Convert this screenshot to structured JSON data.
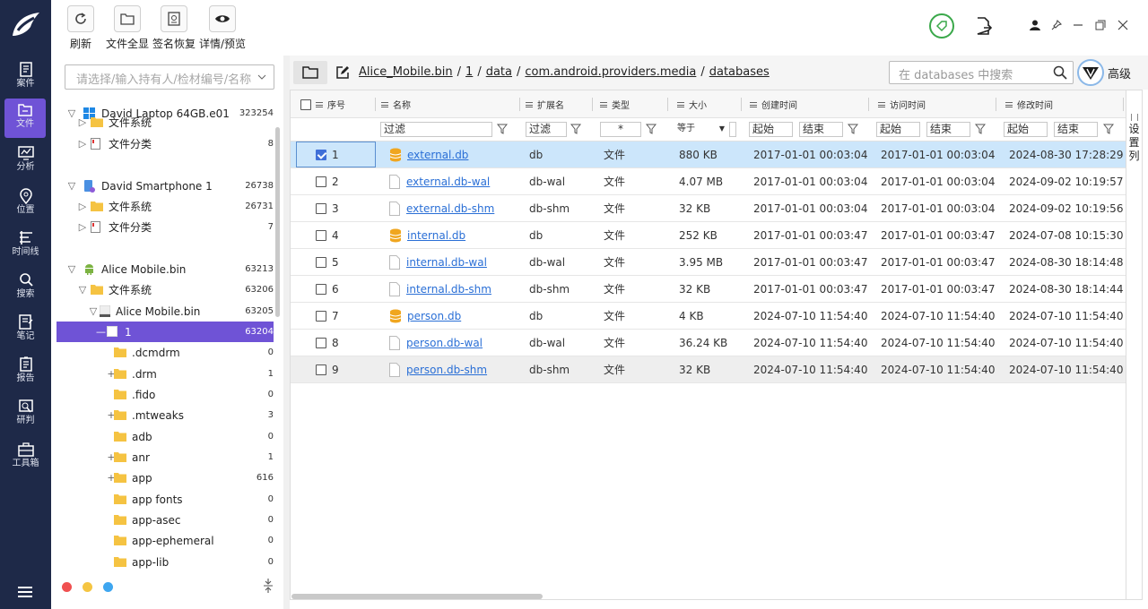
{
  "nav": [
    {
      "label": "案件",
      "icon": "case-icon"
    },
    {
      "label": "文件",
      "icon": "file-icon",
      "active": true
    },
    {
      "label": "分析",
      "icon": "analysis-icon"
    },
    {
      "label": "位置",
      "icon": "location-icon"
    },
    {
      "label": "时间线",
      "icon": "timeline-icon"
    },
    {
      "label": "搜索",
      "icon": "search-icon"
    },
    {
      "label": "笔记",
      "icon": "notes-icon"
    },
    {
      "label": "报告",
      "icon": "report-icon"
    },
    {
      "label": "研判",
      "icon": "judge-icon"
    },
    {
      "label": "工具箱",
      "icon": "toolbox-icon"
    }
  ],
  "toolbar": {
    "refresh": "刷新",
    "show_all": "文件全显",
    "sig_recover": "签名恢复",
    "detail": "详情/预览"
  },
  "tree": {
    "placeholder": "请选择/输入持有人/检材编号/名称",
    "nodes": [
      {
        "toggle": "▽",
        "name": "David Laptop 64GB.e01",
        "count": "323254"
      },
      {
        "toggle": "▷",
        "name": "文件系统",
        "count": ""
      },
      {
        "toggle": "▷",
        "name": "文件分类",
        "count": "8"
      },
      {
        "toggle": "▽",
        "name": "David Smartphone 1",
        "count": "26738"
      },
      {
        "toggle": "▷",
        "name": "文件系统",
        "count": "26731"
      },
      {
        "toggle": "▷",
        "name": "文件分类",
        "count": "7"
      },
      {
        "toggle": "▽",
        "name": "Alice Mobile.bin",
        "count": "63213"
      },
      {
        "toggle": "▽",
        "name": "文件系统",
        "count": "63206"
      },
      {
        "toggle": "▽",
        "name": "Alice Mobile.bin",
        "count": "63205"
      },
      {
        "toggle": "—",
        "name": "1",
        "count": "63204"
      },
      {
        "toggle": "",
        "name": ".dcmdrm",
        "count": "0"
      },
      {
        "toggle": "+",
        "name": ".drm",
        "count": "1"
      },
      {
        "toggle": "",
        "name": ".fido",
        "count": "0"
      },
      {
        "toggle": "+",
        "name": ".mtweaks",
        "count": "3"
      },
      {
        "toggle": "",
        "name": "adb",
        "count": "0"
      },
      {
        "toggle": "+",
        "name": "anr",
        "count": "1"
      },
      {
        "toggle": "+",
        "name": "app",
        "count": "616"
      },
      {
        "toggle": "",
        "name": "app fonts",
        "count": "0"
      },
      {
        "toggle": "",
        "name": "app-asec",
        "count": "0"
      },
      {
        "toggle": "",
        "name": "app-ephemeral",
        "count": "0"
      },
      {
        "toggle": "",
        "name": "app-lib",
        "count": "0"
      }
    ]
  },
  "path": {
    "crumbs": [
      "Alice_Mobile.bin",
      "1",
      "data",
      "com.android.providers.media",
      "databases"
    ],
    "separator": "/",
    "search_placeholder": "在 databases 中搜索",
    "advanced": "高级"
  },
  "table": {
    "columns": [
      "序号",
      "名称",
      "扩展名",
      "类型",
      "大小",
      "创建时间",
      "访问时间",
      "修改时间"
    ],
    "filters": {
      "name": "过滤",
      "ext": "过滤",
      "type": "*",
      "size": "等于",
      "start": "起始",
      "end": "结束"
    },
    "rows": [
      {
        "no": "1",
        "name": "external.db",
        "ext": "db",
        "type": "文件",
        "size": "880 KB",
        "created": "2017-01-01 00:03:04",
        "accessed": "2017-01-01 00:03:04",
        "modified": "2024-08-30 17:28:29",
        "kind": "db",
        "checked": true
      },
      {
        "no": "2",
        "name": "external.db-wal",
        "ext": "db-wal",
        "type": "文件",
        "size": "4.07 MB",
        "created": "2017-01-01 00:03:04",
        "accessed": "2017-01-01 00:03:04",
        "modified": "2024-09-02 10:19:57",
        "kind": "doc",
        "checked": false
      },
      {
        "no": "3",
        "name": "external.db-shm",
        "ext": "db-shm",
        "type": "文件",
        "size": "32 KB",
        "created": "2017-01-01 00:03:04",
        "accessed": "2017-01-01 00:03:04",
        "modified": "2024-09-02 10:19:56",
        "kind": "doc",
        "checked": false
      },
      {
        "no": "4",
        "name": "internal.db",
        "ext": "db",
        "type": "文件",
        "size": "252 KB",
        "created": "2017-01-01 00:03:47",
        "accessed": "2017-01-01 00:03:47",
        "modified": "2024-07-08 10:15:30",
        "kind": "db",
        "checked": false
      },
      {
        "no": "5",
        "name": "internal.db-wal",
        "ext": "db-wal",
        "type": "文件",
        "size": "3.95 MB",
        "created": "2017-01-01 00:03:47",
        "accessed": "2017-01-01 00:03:47",
        "modified": "2024-08-30 18:14:48",
        "kind": "doc",
        "checked": false
      },
      {
        "no": "6",
        "name": "internal.db-shm",
        "ext": "db-shm",
        "type": "文件",
        "size": "32 KB",
        "created": "2017-01-01 00:03:47",
        "accessed": "2017-01-01 00:03:47",
        "modified": "2024-08-30 18:14:44",
        "kind": "doc",
        "checked": false
      },
      {
        "no": "7",
        "name": "person.db",
        "ext": "db",
        "type": "文件",
        "size": "4 KB",
        "created": "2024-07-10 11:54:40",
        "accessed": "2024-07-10 11:54:40",
        "modified": "2024-07-10 11:54:40",
        "kind": "db",
        "checked": false
      },
      {
        "no": "8",
        "name": "person.db-wal",
        "ext": "db-wal",
        "type": "文件",
        "size": "36.24 KB",
        "created": "2024-07-10 11:54:40",
        "accessed": "2024-07-10 11:54:40",
        "modified": "2024-07-10 11:54:40",
        "kind": "doc",
        "checked": false
      },
      {
        "no": "9",
        "name": "person.db-shm",
        "ext": "db-shm",
        "type": "文件",
        "size": "32 KB",
        "created": "2024-07-10 11:54:40",
        "accessed": "2024-07-10 11:54:40",
        "modified": "2024-07-10 11:54:40",
        "kind": "doc",
        "checked": false
      }
    ],
    "set_columns": "设置列"
  },
  "colors": {
    "rail": "#1e2948",
    "accent": "#6f53d6",
    "selected_row": "#cce6fb",
    "link": "#2a6fd6",
    "db_icon": "#f0a61f",
    "dot_red": "#f05050",
    "dot_yellow": "#f5c542",
    "dot_blue": "#3ea6f0"
  }
}
